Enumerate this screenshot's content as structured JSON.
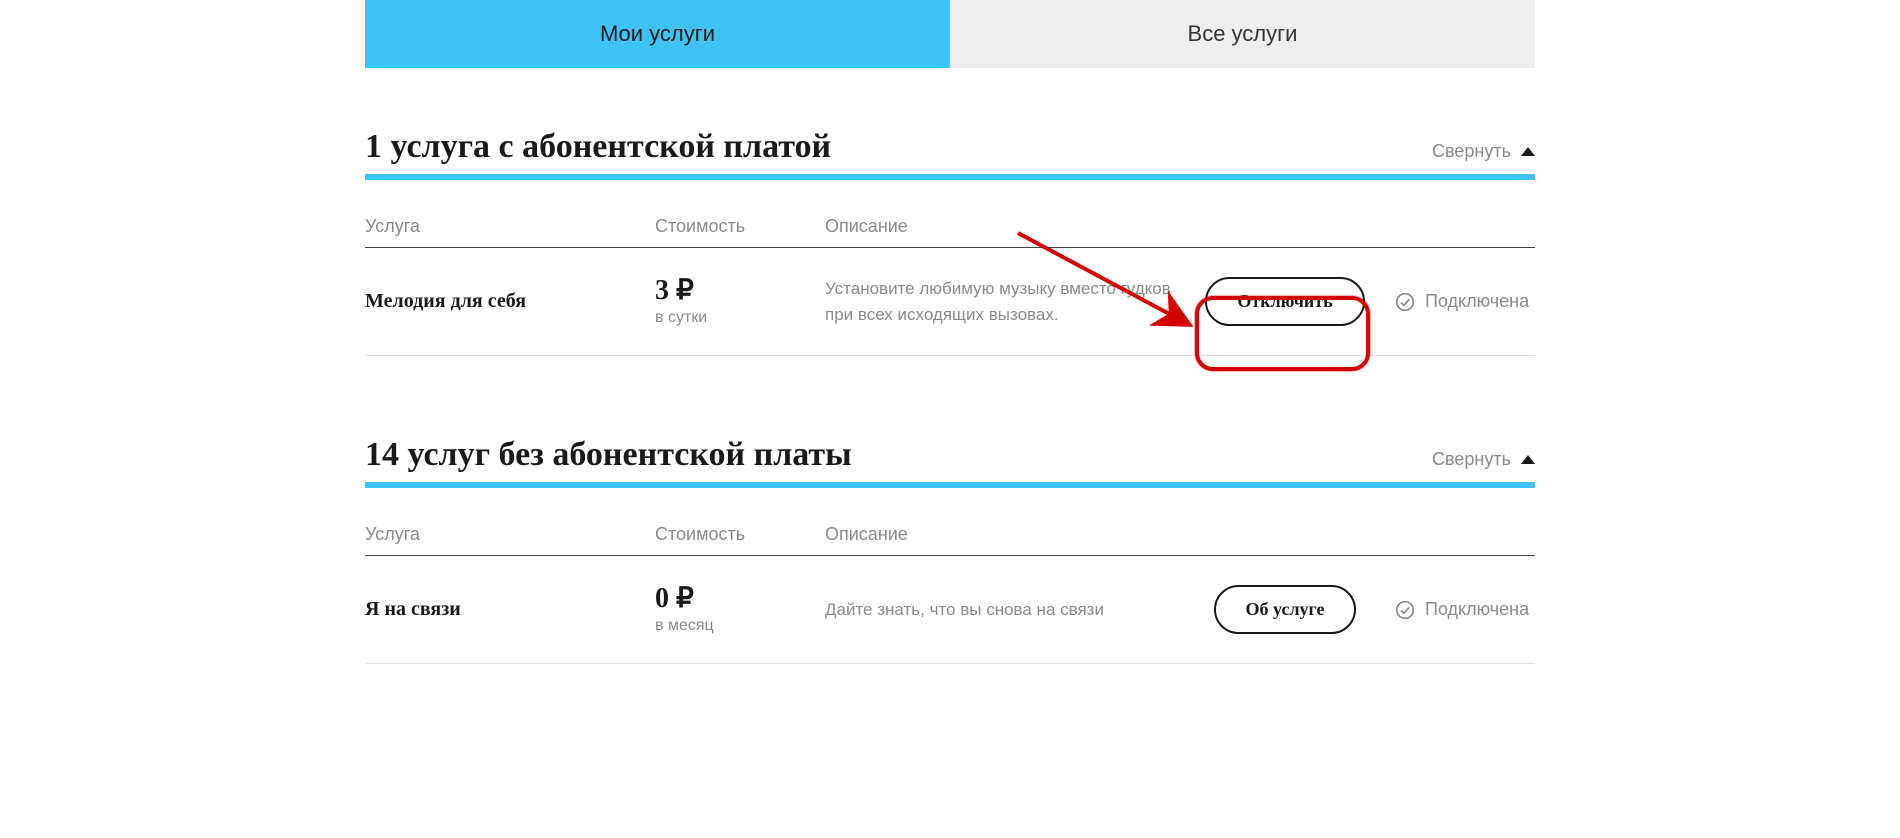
{
  "tabs": {
    "active": "Мои услуги",
    "inactive": "Все услуги"
  },
  "sections": [
    {
      "title": "1 услуга с абонентской платой",
      "collapse_label": "Свернуть",
      "columns": {
        "service": "Услуга",
        "cost": "Стоимость",
        "desc": "Описание"
      },
      "rows": [
        {
          "name": "Мелодия для себя",
          "price_value": "3",
          "price_currency": "₽",
          "price_period": "в сутки",
          "description": "Установите любимую музыку вместо гудков при всех исходящих вызовах.",
          "action_label": "Отключить",
          "status_label": "Подключена"
        }
      ]
    },
    {
      "title": "14 услуг без абонентской платы",
      "collapse_label": "Свернуть",
      "columns": {
        "service": "Услуга",
        "cost": "Стоимость",
        "desc": "Описание"
      },
      "rows": [
        {
          "name": "Я на связи",
          "price_value": "0",
          "price_currency": "₽",
          "price_period": "в месяц",
          "description": "Дайте знать, что вы снова на связи",
          "action_label": "Об услуге",
          "status_label": "Подключена"
        }
      ]
    }
  ]
}
